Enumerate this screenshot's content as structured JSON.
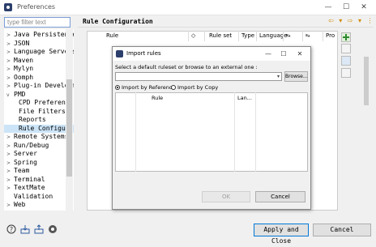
{
  "window": {
    "title": "Preferences",
    "minimize": "—",
    "maximize": "☐",
    "close": "✕"
  },
  "filter": {
    "placeholder": "type filter text"
  },
  "tree": {
    "items": [
      {
        "label": "Java Persistence",
        "arrow": ">",
        "indent": 0
      },
      {
        "label": "JSON",
        "arrow": ">",
        "indent": 0
      },
      {
        "label": "Language Servers",
        "arrow": ">",
        "indent": 0
      },
      {
        "label": "Maven",
        "arrow": ">",
        "indent": 0
      },
      {
        "label": "Mylyn",
        "arrow": ">",
        "indent": 0
      },
      {
        "label": "Oomph",
        "arrow": ">",
        "indent": 0
      },
      {
        "label": "Plug-in Developm",
        "arrow": ">",
        "indent": 0
      },
      {
        "label": "PMD",
        "arrow": "v",
        "indent": 0
      },
      {
        "label": "CPD Preference",
        "arrow": "",
        "indent": 1
      },
      {
        "label": "File Filters",
        "arrow": "",
        "indent": 1
      },
      {
        "label": "Reports",
        "arrow": "",
        "indent": 1
      },
      {
        "label": "Rule Configura",
        "arrow": "",
        "indent": 1,
        "selected": true
      },
      {
        "label": "Remote Systems",
        "arrow": ">",
        "indent": 0
      },
      {
        "label": "Run/Debug",
        "arrow": ">",
        "indent": 0
      },
      {
        "label": "Server",
        "arrow": ">",
        "indent": 0
      },
      {
        "label": "Spring",
        "arrow": ">",
        "indent": 0
      },
      {
        "label": "Team",
        "arrow": ">",
        "indent": 0
      },
      {
        "label": "Terminal",
        "arrow": ">",
        "indent": 0
      },
      {
        "label": "TextMate",
        "arrow": ">",
        "indent": 0
      },
      {
        "label": "Validation",
        "arrow": "",
        "indent": 0
      },
      {
        "label": "Web",
        "arrow": ">",
        "indent": 0
      }
    ]
  },
  "page": {
    "title": "Rule Configuration",
    "nav": "⇦ ▾ ⇨ ▾ ⋮"
  },
  "table": {
    "columns": [
      "Rule",
      "◇",
      "Rule set",
      "Type",
      "Language",
      "⥱",
      "⥱",
      "Pro"
    ]
  },
  "buttons": {
    "apply_close": "Apply and Close",
    "cancel": "Cancel"
  },
  "dialog": {
    "title": "Import rules",
    "minimize": "—",
    "maximize": "☐",
    "close": "✕",
    "prompt": "Select a default ruleset or browse to an external one :",
    "combo_value": "",
    "combo_arrow": "▾",
    "browse": "Browse...",
    "radio_reference": "Import by Reference",
    "radio_copy": "Import by Copy",
    "columns": [
      "Rule",
      "Lan..."
    ],
    "ok": "OK",
    "cancel": "Cancel"
  }
}
